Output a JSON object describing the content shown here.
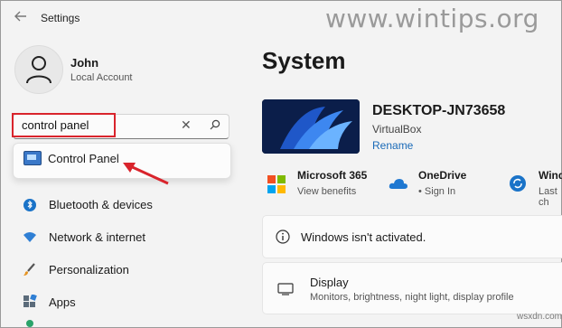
{
  "app": {
    "title": "Settings"
  },
  "watermark": "www.wintips.org",
  "watermark2": "wsxdn.com",
  "user": {
    "name": "John",
    "account": "Local Account"
  },
  "search": {
    "value": "control panel"
  },
  "search_results": [
    {
      "label": "Control Panel",
      "icon": "control-panel-icon"
    }
  ],
  "sidebar": {
    "items": [
      {
        "label": "Bluetooth & devices",
        "icon": "bluetooth-icon"
      },
      {
        "label": "Network & internet",
        "icon": "wifi-icon"
      },
      {
        "label": "Personalization",
        "icon": "brush-icon"
      },
      {
        "label": "Apps",
        "icon": "apps-icon"
      },
      {
        "label": "",
        "icon": "accounts-icon"
      }
    ]
  },
  "main": {
    "title": "System",
    "device": {
      "name": "DESKTOP-JN73658",
      "model": "VirtualBox",
      "rename": "Rename"
    },
    "quick": [
      {
        "title": "Microsoft 365",
        "subtitle": "View benefits",
        "icon": "microsoft-logo-icon"
      },
      {
        "title": "OneDrive",
        "subtitle": "• Sign In",
        "icon": "onedrive-cloud-icon"
      },
      {
        "title": "Wind",
        "subtitle": "Last ch",
        "icon": "windows-update-icon"
      }
    ],
    "activation": {
      "text": "Windows isn't activated.",
      "icon": "info-icon"
    },
    "display": {
      "title": "Display",
      "subtitle": "Monitors, brightness, night light, display profile",
      "icon": "monitor-icon"
    }
  },
  "colors": {
    "accent": "#0067c0",
    "highlight": "#d9242c",
    "background": "#f3f3f3"
  }
}
